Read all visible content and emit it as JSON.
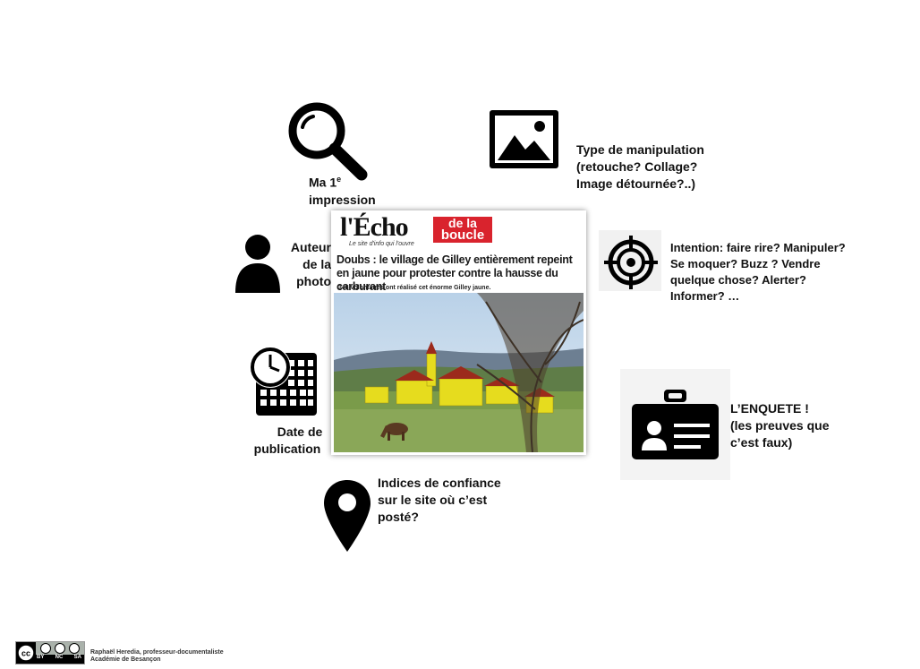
{
  "labels": {
    "first_impression": {
      "line1": "Ma 1",
      "sup": "e",
      "line2": "impression"
    },
    "author": {
      "line1": "Auteur",
      "line2": "de la",
      "line3": "photo"
    },
    "date": {
      "line1": "Date de",
      "line2": "publication"
    },
    "manipulation": {
      "line1": "Type de manipulation",
      "line2": "(retouche? Collage?",
      "line3": "Image détournée?..)"
    },
    "intention": {
      "line1": "Intention: faire rire? Manipuler?",
      "line2": "Se moquer? Buzz ? Vendre",
      "line3": "quelque chose? Alerter?",
      "line4": "Informer? …"
    },
    "investigation": {
      "line1": "L’ENQUETE !",
      "line2": "(les preuves que",
      "line3": "c’est faux)"
    },
    "trust": {
      "line1": "Indices de confiance",
      "line2": "sur le site où c’est",
      "line3": "posté?"
    }
  },
  "article": {
    "logo_main": "l'Écho",
    "logo_box_line1": "de la",
    "logo_box_line2": "boucle",
    "tagline": "Le site d'info qui l'ouvre",
    "headline": "Doubs : le village de Gilley entièrement repeint en jaune pour protester contre la hausse du carburant",
    "subline": "348 volontaires ont réalisé cet énorme Gilley jaune."
  },
  "footer": {
    "cc_tags": [
      "BY",
      "NC",
      "SA"
    ],
    "credit_line1": "Raphaël Heredia, professeur-documentaliste",
    "credit_line2": "Académie de Besançon"
  },
  "icons": [
    "magnifier-icon",
    "image-icon",
    "person-icon",
    "target-icon",
    "calendar-clock-icon",
    "id-badge-icon",
    "map-pin-icon",
    "creative-commons-icon"
  ],
  "colors": {
    "icon": "#000000",
    "brand_red": "#d9232d",
    "house_yellow": "#e6dc1e"
  }
}
